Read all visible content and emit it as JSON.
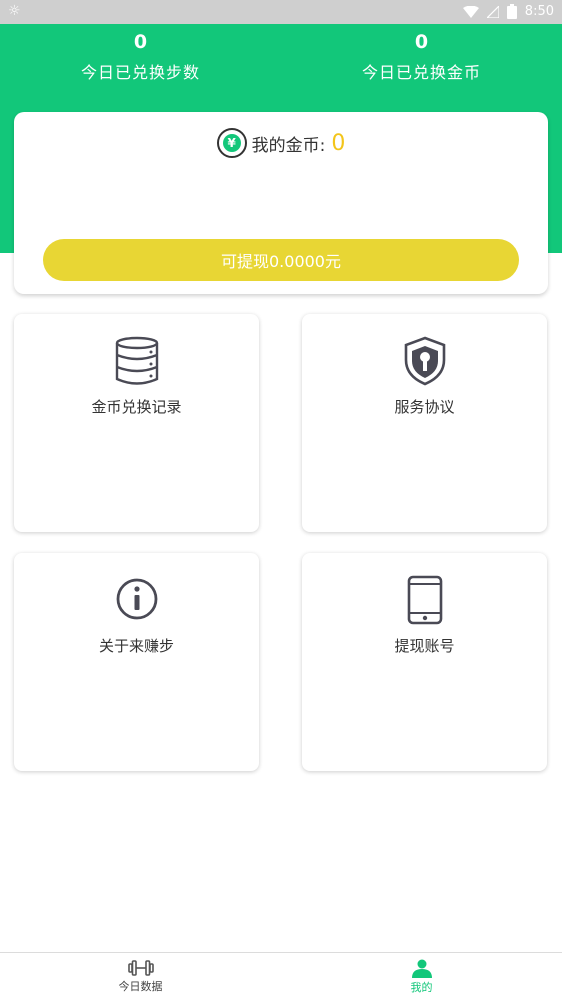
{
  "status_bar": {
    "time": "8:50"
  },
  "header": {
    "stats": [
      {
        "value": "0",
        "label": "今日已兑换步数"
      },
      {
        "value": "0",
        "label": "今日已兑换金币"
      }
    ]
  },
  "coin_card": {
    "coin_symbol": "¥",
    "label": "我的金币:",
    "value": "0",
    "withdraw_button": "可提现0.0000元"
  },
  "tiles": [
    {
      "label": "金币兑换记录",
      "icon": "database-icon"
    },
    {
      "label": "服务协议",
      "icon": "shield-keyhole-icon"
    },
    {
      "label": "关于来赚步",
      "icon": "info-icon"
    },
    {
      "label": "提现账号",
      "icon": "phone-icon"
    }
  ],
  "tabbar": {
    "tabs": [
      {
        "label": "今日数据",
        "icon": "dumbbell-icon",
        "active": false
      },
      {
        "label": "我的",
        "icon": "person-icon",
        "active": true
      }
    ]
  },
  "colors": {
    "primary": "#12c77a",
    "button": "#e8d634",
    "coin": "#f3c51a"
  }
}
